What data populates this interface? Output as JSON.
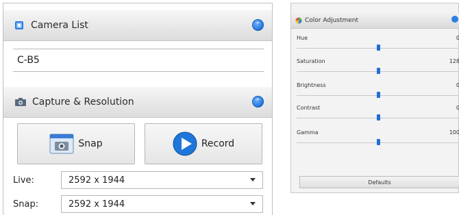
{
  "camera_section": {
    "title": "Camera List",
    "icon": "camera-list-icon",
    "collapse_icon": "chevron-up-icon",
    "selected_camera": "C-B5"
  },
  "capture_section": {
    "title": "Capture & Resolution",
    "icon": "camera-icon",
    "collapse_icon": "chevron-up-icon",
    "snap_label": "Snap",
    "record_label": "Record",
    "live_label": "Live:",
    "live_value": "2592 x 1944",
    "snap_res_label": "Snap:",
    "snap_res_value": "2592 x 1944"
  },
  "color_adjustment": {
    "title": "Color Adjustment",
    "icon": "color-wheel-icon",
    "rows": [
      {
        "label": "Hue",
        "value": "0",
        "level": 0.5
      },
      {
        "label": "Saturation",
        "value": "128",
        "level": 0.5
      },
      {
        "label": "Brightness",
        "value": "0",
        "level": 0.5
      },
      {
        "label": "Contrast",
        "value": "0",
        "level": 0.5
      },
      {
        "label": "Gamma",
        "value": "100",
        "level": 0.5
      }
    ],
    "defaults_label": "Defaults"
  },
  "colors": {
    "accent": "#1e6fd9",
    "header_bg": "#e3e3e3"
  }
}
